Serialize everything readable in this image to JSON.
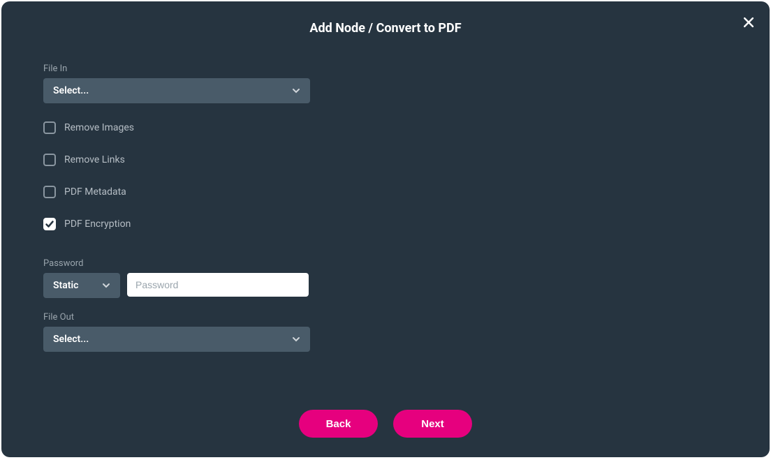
{
  "title": "Add Node / Convert to PDF",
  "fileIn": {
    "label": "File In",
    "value": "Select..."
  },
  "checkboxes": {
    "removeImages": {
      "label": "Remove Images",
      "checked": false
    },
    "removeLinks": {
      "label": "Remove Links",
      "checked": false
    },
    "pdfMetadata": {
      "label": "PDF Metadata",
      "checked": false
    },
    "pdfEncryption": {
      "label": "PDF Encryption",
      "checked": true
    }
  },
  "password": {
    "label": "Password",
    "modeValue": "Static",
    "placeholder": "Password",
    "value": ""
  },
  "fileOut": {
    "label": "File Out",
    "value": "Select..."
  },
  "buttons": {
    "back": "Back",
    "next": "Next"
  }
}
